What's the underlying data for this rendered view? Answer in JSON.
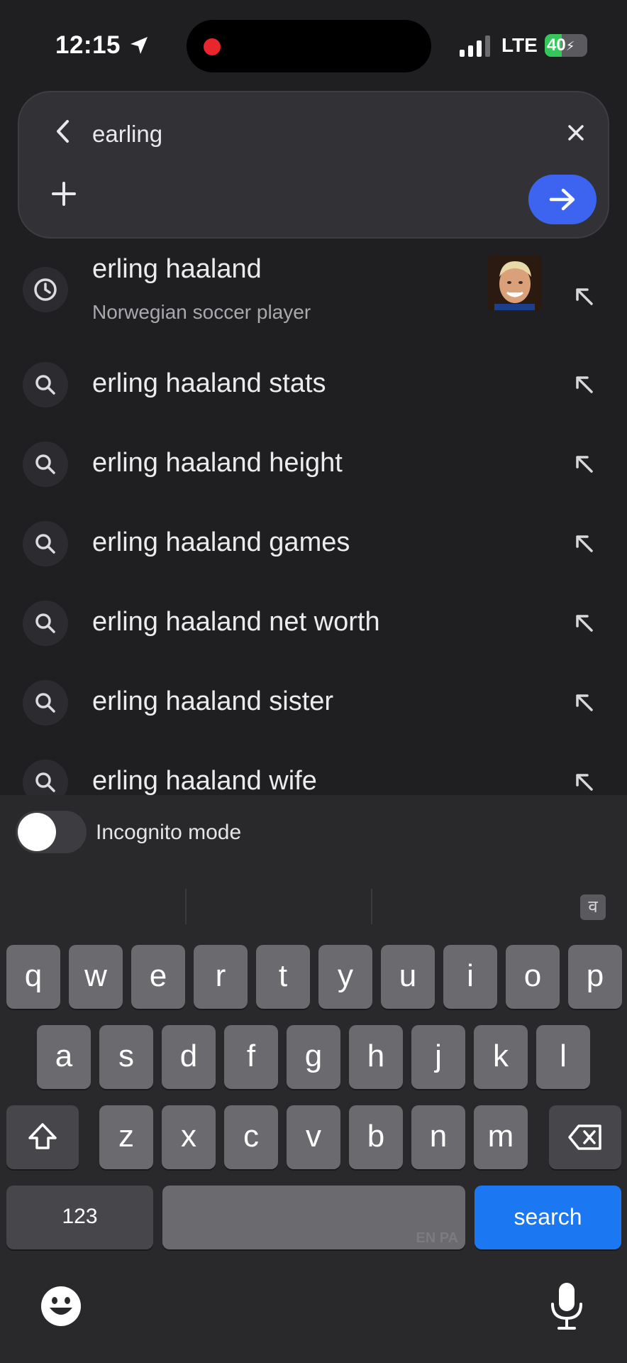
{
  "status": {
    "time": "12:15",
    "network": "LTE",
    "battery": "40",
    "battery_level": 0.4
  },
  "search": {
    "query": "earling"
  },
  "suggestions": [
    {
      "text": "erling haaland",
      "subtitle": "Norwegian soccer player",
      "icon": "history-clock-icon",
      "has_thumbnail": true
    },
    {
      "text": "erling haaland stats",
      "icon": "search-icon"
    },
    {
      "text": "erling haaland height",
      "icon": "search-icon"
    },
    {
      "text": "erling haaland games",
      "icon": "search-icon"
    },
    {
      "text": "erling haaland net worth",
      "icon": "search-icon"
    },
    {
      "text": "erling haaland sister",
      "icon": "search-icon"
    },
    {
      "text": "erling haaland wife",
      "icon": "search-icon"
    }
  ],
  "incognito": {
    "label": "Incognito mode",
    "enabled": false
  },
  "keyboard": {
    "lang_switch_glyph": "व",
    "row1": [
      "q",
      "w",
      "e",
      "r",
      "t",
      "y",
      "u",
      "i",
      "o",
      "p"
    ],
    "row2": [
      "a",
      "s",
      "d",
      "f",
      "g",
      "h",
      "j",
      "k",
      "l"
    ],
    "row3": [
      "z",
      "x",
      "c",
      "v",
      "b",
      "n",
      "m"
    ],
    "numbers_label": "123",
    "space_hint": "EN PA",
    "search_label": "search"
  },
  "colors": {
    "accent_blue": "#3d64f0",
    "keyboard_search": "#1b78f2",
    "recording_dot": "#e8262b",
    "battery_green": "#34c759"
  }
}
